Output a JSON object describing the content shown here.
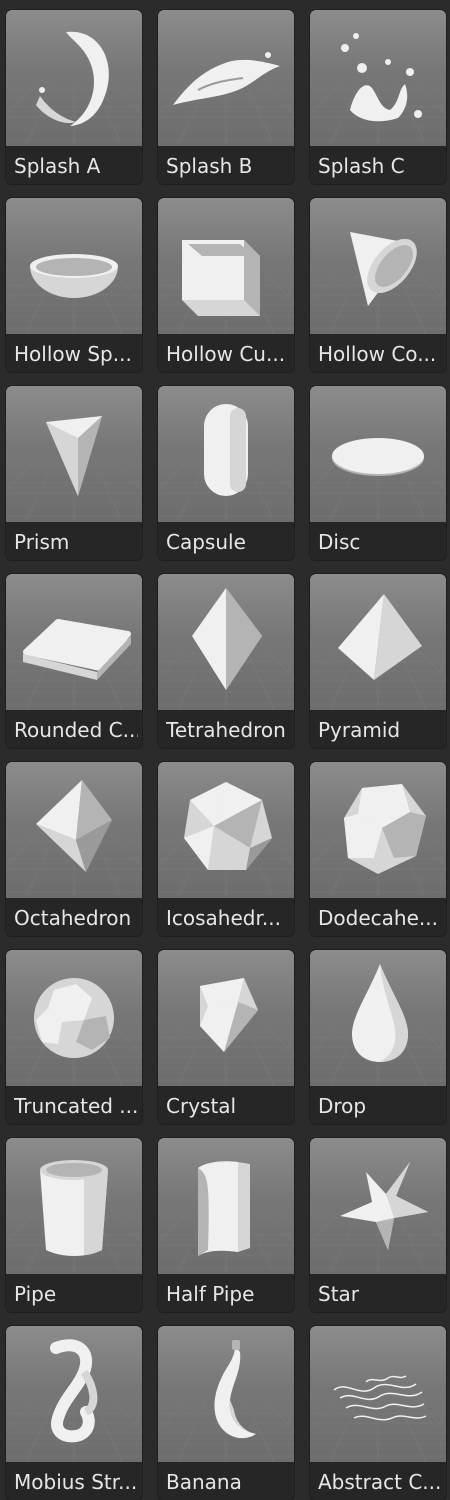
{
  "shapes": [
    {
      "label": "Splash A",
      "icon": "splash-a-icon"
    },
    {
      "label": "Splash B",
      "icon": "splash-b-icon"
    },
    {
      "label": "Splash C",
      "icon": "splash-c-icon"
    },
    {
      "label": "Hollow Sp...",
      "icon": "hollow-sphere-icon"
    },
    {
      "label": "Hollow Cu...",
      "icon": "hollow-cube-icon"
    },
    {
      "label": "Hollow Co...",
      "icon": "hollow-cone-icon"
    },
    {
      "label": "Prism",
      "icon": "prism-icon"
    },
    {
      "label": "Capsule",
      "icon": "capsule-icon"
    },
    {
      "label": "Disc",
      "icon": "disc-icon"
    },
    {
      "label": "Rounded C...",
      "icon": "rounded-cube-icon"
    },
    {
      "label": "Tetrahedron",
      "icon": "tetrahedron-icon"
    },
    {
      "label": "Pyramid",
      "icon": "pyramid-icon"
    },
    {
      "label": "Octahedron",
      "icon": "octahedron-icon"
    },
    {
      "label": "Icosahedr...",
      "icon": "icosahedron-icon"
    },
    {
      "label": "Dodecahe...",
      "icon": "dodecahedron-icon"
    },
    {
      "label": "Truncated ...",
      "icon": "truncated-icon"
    },
    {
      "label": "Crystal",
      "icon": "crystal-icon"
    },
    {
      "label": "Drop",
      "icon": "drop-icon"
    },
    {
      "label": "Pipe",
      "icon": "pipe-icon"
    },
    {
      "label": "Half Pipe",
      "icon": "half-pipe-icon"
    },
    {
      "label": "Star",
      "icon": "star-icon"
    },
    {
      "label": "Mobius Str...",
      "icon": "mobius-strip-icon"
    },
    {
      "label": "Banana",
      "icon": "banana-icon"
    },
    {
      "label": "Abstract C...",
      "icon": "abstract-curve-icon"
    }
  ],
  "colors": {
    "background": "#2b2b2b",
    "tile": "#262626",
    "label_text": "#e6e6e6",
    "shape": "#eeeeee"
  }
}
